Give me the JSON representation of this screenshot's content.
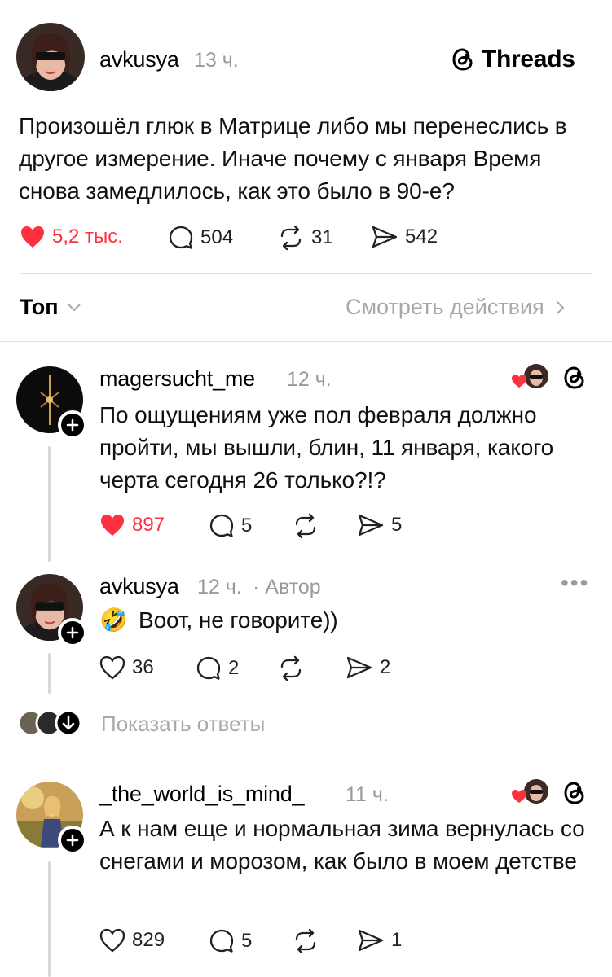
{
  "brand": {
    "name": "Threads"
  },
  "post": {
    "username": "avkusya",
    "time": "13 ч.",
    "text": "Произошёл глюк в Матрице либо мы перенеслись в другое измерение. Иначе почему с января Время снова замедлилось, как это было в 90-е?",
    "likes": "5,2 тыс.",
    "replies": "504",
    "reposts": "31",
    "shares": "542"
  },
  "sort_bar": {
    "sort_label": "Топ",
    "view_activity": "Смотреть действия"
  },
  "comments": [
    {
      "username": "magersucht_me",
      "time": "12 ч.",
      "text": "По ощущениям уже пол февраля должно пройти, мы вышли, блин, 11 января, какого черта сегодня 26 только?!?",
      "likes": "897",
      "replies": "5",
      "reposts": "",
      "shares": "5"
    },
    {
      "username": "avkusya",
      "time": "12 ч.",
      "author_tag": "· Автор",
      "text": "Воот, не говорите))",
      "emoji": "🤣",
      "likes": "36",
      "replies": "2",
      "reposts": "",
      "shares": "2",
      "show_replies": "Показать ответы"
    },
    {
      "username": "_the_world_is_mind_",
      "time": "11 ч.",
      "text": "А к нам еще и нормальная зима вернулась со снегами и морозом, как было в моем детстве",
      "likes": "829",
      "replies": "5",
      "reposts": "",
      "shares": "1"
    }
  ],
  "colors": {
    "like_red": "#ff3040",
    "muted_text": "#9a9a9a",
    "divider": "#e2e2e2"
  },
  "icons": [
    "heart-icon",
    "comment-icon",
    "repost-icon",
    "share-icon",
    "threads-logo-icon",
    "chevron-down-icon",
    "chevron-right-icon",
    "plus-icon",
    "more-icon",
    "arrow-down-icon"
  ]
}
